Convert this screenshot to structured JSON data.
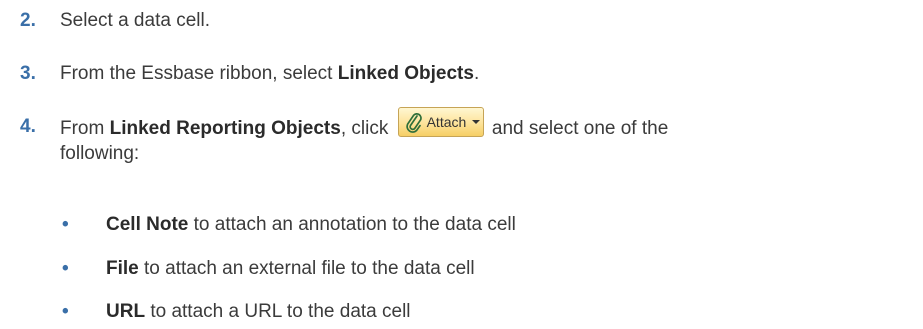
{
  "steps": [
    {
      "number": "2.",
      "text": "Select a data cell."
    },
    {
      "number": "3.",
      "prefix": "From the Essbase ribbon, select ",
      "bold": "Linked Objects",
      "suffix": "."
    },
    {
      "number": "4.",
      "prefix": "From ",
      "bold": "Linked Reporting Objects",
      "middle": ", click ",
      "suffix": " and select one of the",
      "continuation": "following:"
    }
  ],
  "attach_button": {
    "label": "Attach",
    "icon": "paperclip-icon",
    "dropdown_icon": "chevron-down-icon",
    "colors": {
      "top": "#fff7d2",
      "bottom": "#f6cf66",
      "border": "#c6a456"
    }
  },
  "options": [
    {
      "bold": "Cell Note",
      "text": " to attach an annotation to the data cell"
    },
    {
      "bold": "File",
      "text": " to attach an external file to the data cell"
    },
    {
      "bold": "URL",
      "text": " to attach a URL to the data cell"
    }
  ],
  "colors": {
    "step_number": "#3a6fa8",
    "bullet": "#3a6fa8",
    "body_text": "#3b3b3b"
  }
}
